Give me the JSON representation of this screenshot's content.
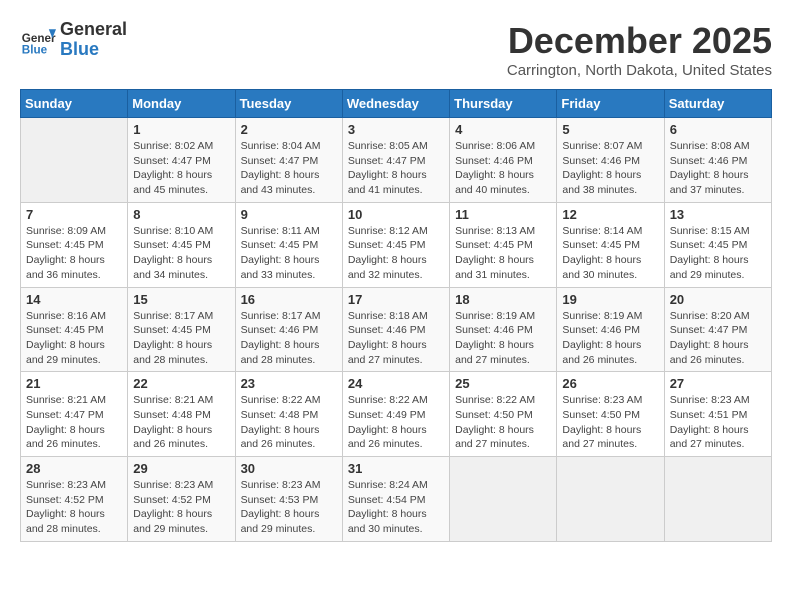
{
  "header": {
    "logo_line1": "General",
    "logo_line2": "Blue",
    "month_title": "December 2025",
    "location": "Carrington, North Dakota, United States"
  },
  "weekdays": [
    "Sunday",
    "Monday",
    "Tuesday",
    "Wednesday",
    "Thursday",
    "Friday",
    "Saturday"
  ],
  "weeks": [
    [
      {
        "day": "",
        "info": ""
      },
      {
        "day": "1",
        "info": "Sunrise: 8:02 AM\nSunset: 4:47 PM\nDaylight: 8 hours\nand 45 minutes."
      },
      {
        "day": "2",
        "info": "Sunrise: 8:04 AM\nSunset: 4:47 PM\nDaylight: 8 hours\nand 43 minutes."
      },
      {
        "day": "3",
        "info": "Sunrise: 8:05 AM\nSunset: 4:47 PM\nDaylight: 8 hours\nand 41 minutes."
      },
      {
        "day": "4",
        "info": "Sunrise: 8:06 AM\nSunset: 4:46 PM\nDaylight: 8 hours\nand 40 minutes."
      },
      {
        "day": "5",
        "info": "Sunrise: 8:07 AM\nSunset: 4:46 PM\nDaylight: 8 hours\nand 38 minutes."
      },
      {
        "day": "6",
        "info": "Sunrise: 8:08 AM\nSunset: 4:46 PM\nDaylight: 8 hours\nand 37 minutes."
      }
    ],
    [
      {
        "day": "7",
        "info": "Sunrise: 8:09 AM\nSunset: 4:45 PM\nDaylight: 8 hours\nand 36 minutes."
      },
      {
        "day": "8",
        "info": "Sunrise: 8:10 AM\nSunset: 4:45 PM\nDaylight: 8 hours\nand 34 minutes."
      },
      {
        "day": "9",
        "info": "Sunrise: 8:11 AM\nSunset: 4:45 PM\nDaylight: 8 hours\nand 33 minutes."
      },
      {
        "day": "10",
        "info": "Sunrise: 8:12 AM\nSunset: 4:45 PM\nDaylight: 8 hours\nand 32 minutes."
      },
      {
        "day": "11",
        "info": "Sunrise: 8:13 AM\nSunset: 4:45 PM\nDaylight: 8 hours\nand 31 minutes."
      },
      {
        "day": "12",
        "info": "Sunrise: 8:14 AM\nSunset: 4:45 PM\nDaylight: 8 hours\nand 30 minutes."
      },
      {
        "day": "13",
        "info": "Sunrise: 8:15 AM\nSunset: 4:45 PM\nDaylight: 8 hours\nand 29 minutes."
      }
    ],
    [
      {
        "day": "14",
        "info": "Sunrise: 8:16 AM\nSunset: 4:45 PM\nDaylight: 8 hours\nand 29 minutes."
      },
      {
        "day": "15",
        "info": "Sunrise: 8:17 AM\nSunset: 4:45 PM\nDaylight: 8 hours\nand 28 minutes."
      },
      {
        "day": "16",
        "info": "Sunrise: 8:17 AM\nSunset: 4:46 PM\nDaylight: 8 hours\nand 28 minutes."
      },
      {
        "day": "17",
        "info": "Sunrise: 8:18 AM\nSunset: 4:46 PM\nDaylight: 8 hours\nand 27 minutes."
      },
      {
        "day": "18",
        "info": "Sunrise: 8:19 AM\nSunset: 4:46 PM\nDaylight: 8 hours\nand 27 minutes."
      },
      {
        "day": "19",
        "info": "Sunrise: 8:19 AM\nSunset: 4:46 PM\nDaylight: 8 hours\nand 26 minutes."
      },
      {
        "day": "20",
        "info": "Sunrise: 8:20 AM\nSunset: 4:47 PM\nDaylight: 8 hours\nand 26 minutes."
      }
    ],
    [
      {
        "day": "21",
        "info": "Sunrise: 8:21 AM\nSunset: 4:47 PM\nDaylight: 8 hours\nand 26 minutes."
      },
      {
        "day": "22",
        "info": "Sunrise: 8:21 AM\nSunset: 4:48 PM\nDaylight: 8 hours\nand 26 minutes."
      },
      {
        "day": "23",
        "info": "Sunrise: 8:22 AM\nSunset: 4:48 PM\nDaylight: 8 hours\nand 26 minutes."
      },
      {
        "day": "24",
        "info": "Sunrise: 8:22 AM\nSunset: 4:49 PM\nDaylight: 8 hours\nand 26 minutes."
      },
      {
        "day": "25",
        "info": "Sunrise: 8:22 AM\nSunset: 4:50 PM\nDaylight: 8 hours\nand 27 minutes."
      },
      {
        "day": "26",
        "info": "Sunrise: 8:23 AM\nSunset: 4:50 PM\nDaylight: 8 hours\nand 27 minutes."
      },
      {
        "day": "27",
        "info": "Sunrise: 8:23 AM\nSunset: 4:51 PM\nDaylight: 8 hours\nand 27 minutes."
      }
    ],
    [
      {
        "day": "28",
        "info": "Sunrise: 8:23 AM\nSunset: 4:52 PM\nDaylight: 8 hours\nand 28 minutes."
      },
      {
        "day": "29",
        "info": "Sunrise: 8:23 AM\nSunset: 4:52 PM\nDaylight: 8 hours\nand 29 minutes."
      },
      {
        "day": "30",
        "info": "Sunrise: 8:23 AM\nSunset: 4:53 PM\nDaylight: 8 hours\nand 29 minutes."
      },
      {
        "day": "31",
        "info": "Sunrise: 8:24 AM\nSunset: 4:54 PM\nDaylight: 8 hours\nand 30 minutes."
      },
      {
        "day": "",
        "info": ""
      },
      {
        "day": "",
        "info": ""
      },
      {
        "day": "",
        "info": ""
      }
    ]
  ]
}
